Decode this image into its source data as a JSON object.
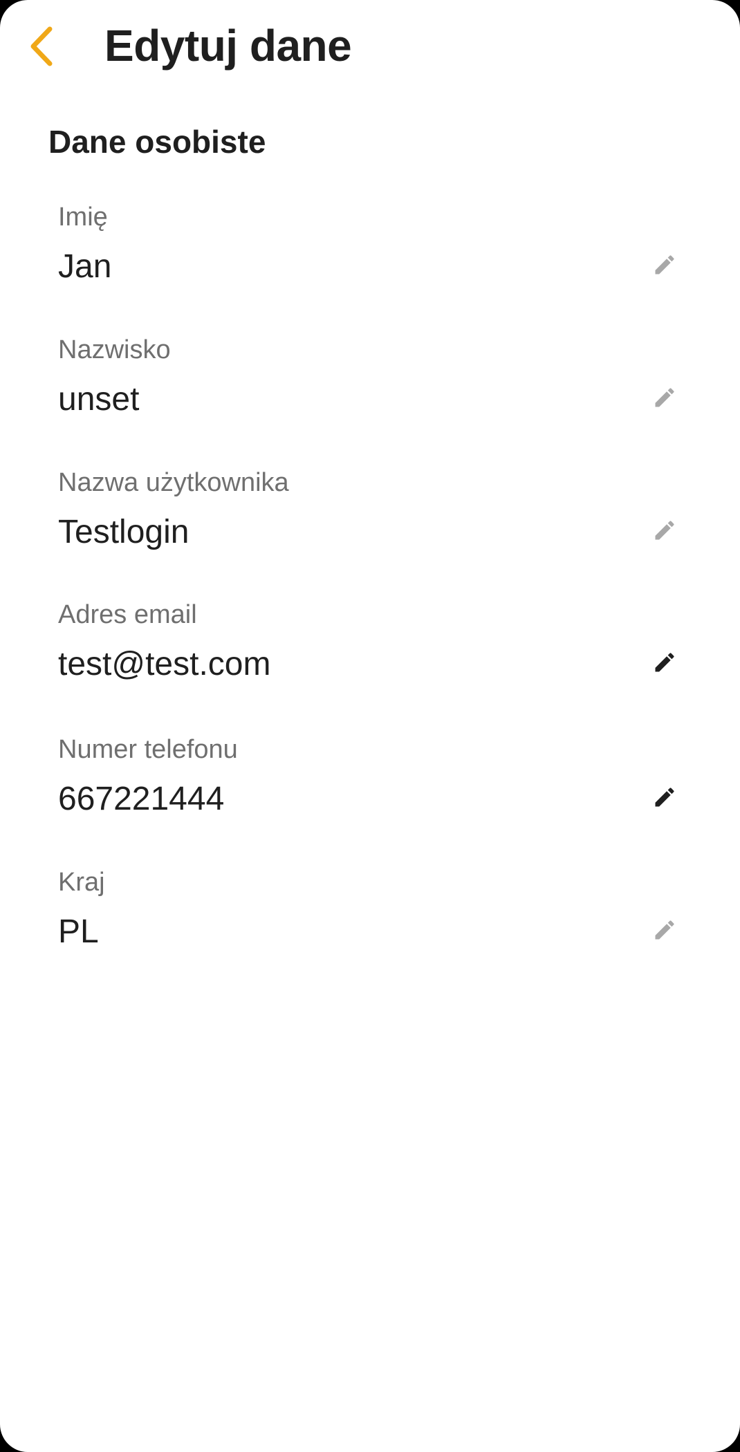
{
  "header": {
    "back_icon": "chevron-left-icon",
    "title": "Edytuj dane"
  },
  "colors": {
    "accent": "#f0a818",
    "text_primary": "#1f1f1f",
    "text_label": "#6f6f6f",
    "icon_disabled": "#a8a8a8",
    "icon_enabled": "#1f1f1f"
  },
  "section": {
    "title": "Dane osobiste"
  },
  "fields": [
    {
      "label": "Imię",
      "value": "Jan",
      "edit_icon": "pencil-icon",
      "editable": false
    },
    {
      "label": "Nazwisko",
      "value": "unset",
      "edit_icon": "pencil-icon",
      "editable": false
    },
    {
      "label": "Nazwa użytkownika",
      "value": "Testlogin",
      "edit_icon": "pencil-icon",
      "editable": false
    },
    {
      "label": "Adres email",
      "value": "test@test.com",
      "edit_icon": "pencil-icon",
      "editable": true
    },
    {
      "label": "Numer telefonu",
      "value": "667221444",
      "edit_icon": "pencil-icon",
      "editable": true
    },
    {
      "label": "Kraj",
      "value": "PL",
      "edit_icon": "pencil-icon",
      "editable": false
    }
  ]
}
